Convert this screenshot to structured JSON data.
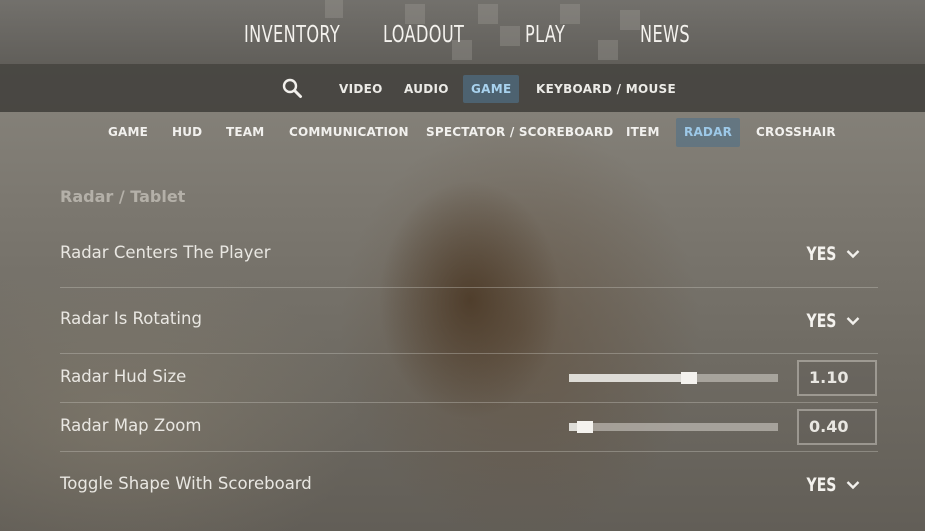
{
  "main_nav": [
    "INVENTORY",
    "LOADOUT",
    "PLAY",
    "NEWS"
  ],
  "settings_tabs": [
    "VIDEO",
    "AUDIO",
    "GAME",
    "KEYBOARD / MOUSE"
  ],
  "settings_active_tab": "GAME",
  "sub_tabs": [
    "GAME",
    "HUD",
    "TEAM",
    "COMMUNICATION",
    "SPECTATOR / SCOREBOARD",
    "ITEM",
    "RADAR",
    "CROSSHAIR"
  ],
  "sub_active_tab": "RADAR",
  "section_title": "Radar / Tablet",
  "settings": {
    "radar_centers": {
      "label": "Radar Centers The Player",
      "value": "YES"
    },
    "radar_rotating": {
      "label": "Radar Is Rotating",
      "value": "YES"
    },
    "radar_hud_size": {
      "label": "Radar Hud Size",
      "value": "1.10",
      "slider_fraction": 0.58
    },
    "radar_map_zoom": {
      "label": "Radar Map Zoom",
      "value": "0.40",
      "slider_fraction": 0.04
    },
    "toggle_shape": {
      "label": "Toggle Shape With Scoreboard",
      "value": "YES"
    }
  },
  "icons": {
    "search": "search-icon",
    "dropdown": "chevron-down-icon"
  },
  "colors": {
    "active_tab_text": "#a8d2ee",
    "active_tab_bg": "#4f7896"
  }
}
